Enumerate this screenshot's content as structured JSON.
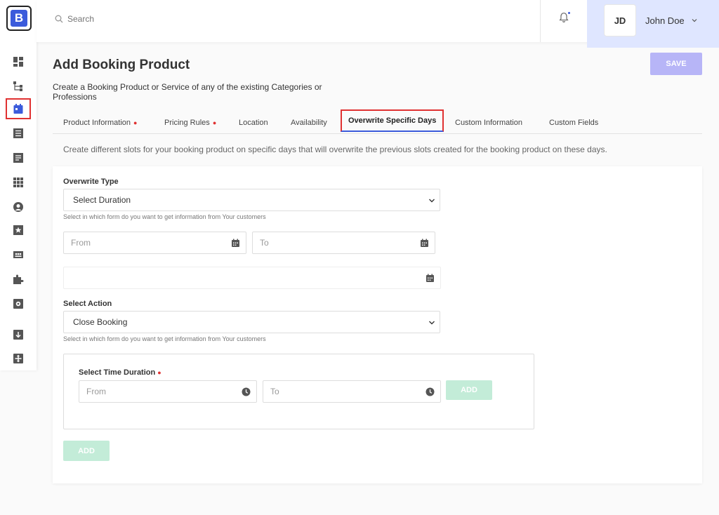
{
  "brand": {
    "logo_letter": "B"
  },
  "sidebar": {
    "items": [
      {
        "icon": "dashboard-icon"
      },
      {
        "icon": "hierarchy-icon"
      },
      {
        "icon": "calendar-icon",
        "active": true
      },
      {
        "icon": "list-icon"
      },
      {
        "icon": "document-icon"
      },
      {
        "icon": "grid-icon"
      },
      {
        "icon": "user-icon"
      },
      {
        "icon": "star-icon"
      },
      {
        "icon": "group-icon"
      },
      {
        "icon": "puzzle-icon"
      },
      {
        "icon": "gear-icon"
      },
      {
        "icon": "download-icon"
      },
      {
        "icon": "expand-icon"
      }
    ]
  },
  "topbar": {
    "search_placeholder": "Search",
    "user_initials": "JD",
    "user_name": "John Doe"
  },
  "header": {
    "title": "Add Booking Product",
    "subtitle": "Create a Booking Product or Service of any of the existing Categories or Professions",
    "save_label": "SAVE"
  },
  "tabs": [
    {
      "label": "Product Information",
      "required": true
    },
    {
      "label": "Pricing Rules",
      "required": true
    },
    {
      "label": "Location",
      "required": false
    },
    {
      "label": "Availability",
      "required": false
    },
    {
      "label": "Overwrite Specific Days",
      "required": false,
      "active": true
    },
    {
      "label": "Custom Information",
      "required": false
    },
    {
      "label": "Custom Fields",
      "required": false
    }
  ],
  "tab_description": "Create different slots for your booking product on specific days that will overwrite the previous slots created for the booking product on these days.",
  "form": {
    "overwrite_type_label": "Overwrite Type",
    "overwrite_type_value": "Select Duration",
    "overwrite_type_help": "Select in which form do you want to get information from Your customers",
    "from_placeholder": "From",
    "to_placeholder": "To",
    "date_value": "",
    "select_action_label": "Select Action",
    "select_action_value": "Close Booking",
    "select_action_help": "Select in which form do you want to get information from Your customers",
    "time_duration_label": "Select Time Duration",
    "time_from_placeholder": "From",
    "time_to_placeholder": "To",
    "inner_add_label": "ADD",
    "add_label": "ADD"
  },
  "colors": {
    "accent": "#3b5bdb",
    "required": "#e03131",
    "save_button": "#b7b5f7",
    "add_button": "#c3ecd8",
    "user_panel": "#dfe6ff"
  }
}
